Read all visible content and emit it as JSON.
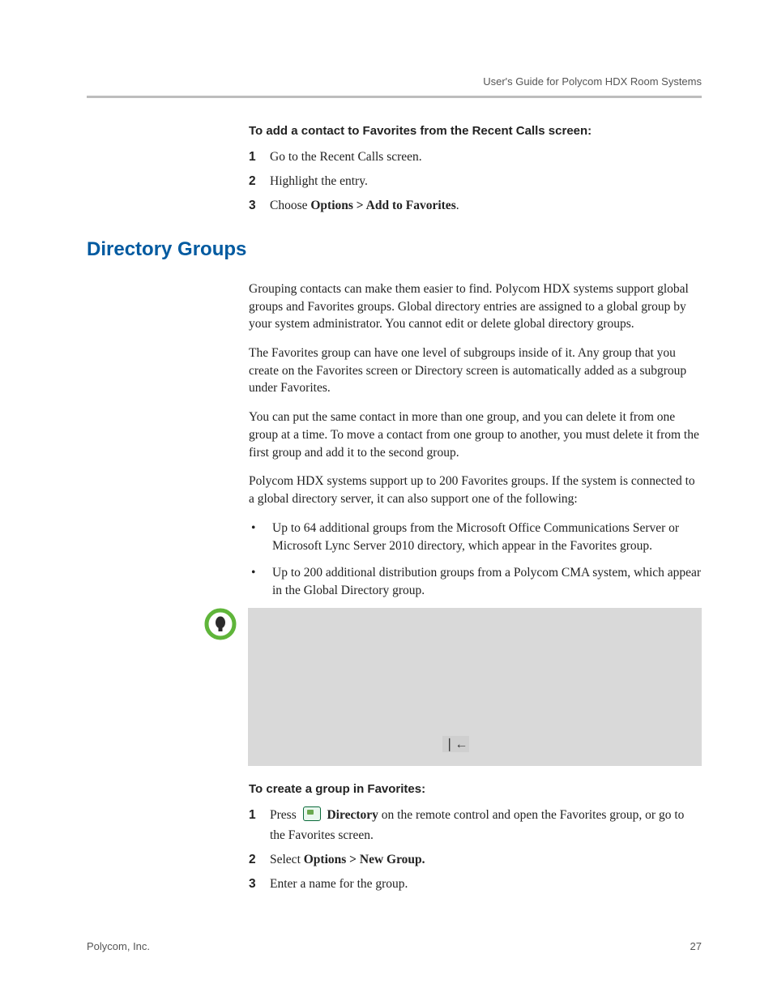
{
  "header": {
    "doc_title": "User's Guide for Polycom HDX Room Systems"
  },
  "section1": {
    "heading": "To add a contact to Favorites from the Recent Calls screen:",
    "steps": [
      {
        "n": "1",
        "text": "Go to the Recent Calls screen."
      },
      {
        "n": "2",
        "text": "Highlight the entry."
      },
      {
        "n": "3",
        "prefix": "Choose ",
        "bold": "Options > Add to Favorites",
        "suffix": "."
      }
    ]
  },
  "section2": {
    "title": "Directory Groups",
    "paras": [
      "Grouping contacts can make them easier to find. Polycom HDX systems support global groups and Favorites groups. Global directory entries are assigned to a global group by your system administrator. You cannot edit or delete global directory groups.",
      "The Favorites group can have one level of subgroups inside of it. Any group that you create on the Favorites screen or Directory screen is automatically added as a subgroup under Favorites.",
      "You can put the same contact in more than one group, and you can delete it from one group at a time. To move a contact from one group to another, you must delete it from the first group and add it to the second group.",
      "Polycom HDX systems support up to 200 Favorites groups. If the system is connected to a global directory server, it can also support one of the following:"
    ],
    "bullets": [
      "Up to 64 additional groups from the Microsoft Office Communications Server or Microsoft Lync Server 2010 directory, which appear in the Favorites group.",
      "Up to 200 additional distribution groups from a Polycom CMA system, which appear in the Global Directory group."
    ]
  },
  "note": {
    "arrow": "❘←"
  },
  "section3": {
    "heading": "To create a group in Favorites:",
    "steps": [
      {
        "n": "1",
        "prefix": "Press ",
        "icon": true,
        "bold": "Directory",
        "suffix": " on the remote control and open the Favorites group, or go to the Favorites screen."
      },
      {
        "n": "2",
        "prefix": "Select ",
        "bold": "Options > New Group.",
        "suffix": ""
      },
      {
        "n": "3",
        "text": "Enter a name for the group."
      }
    ]
  },
  "footer": {
    "company": "Polycom, Inc.",
    "page": "27"
  }
}
